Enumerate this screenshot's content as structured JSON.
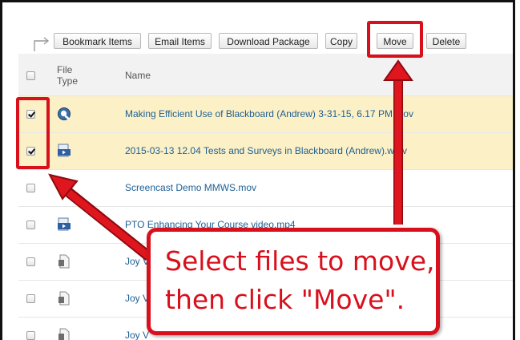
{
  "toolbar": {
    "buttons": [
      "Bookmark Items",
      "Email Items",
      "Download Package",
      "Copy",
      "Move",
      "Delete"
    ]
  },
  "table": {
    "headers": {
      "file_type": "File Type",
      "name": "Name"
    },
    "rows": [
      {
        "name": "Making Efficient Use of Blackboard (Andrew) 3-31-15, 6.17 PM.mov",
        "checked": true,
        "icon": "quicktime-video-icon"
      },
      {
        "name": "2015-03-13 12.04 Tests and Surveys in Blackboard (Andrew).wmv",
        "checked": true,
        "icon": "windows-media-video-icon"
      },
      {
        "name": "Screencast Demo MMWS.mov",
        "checked": false,
        "icon": "quicktime-video-icon"
      },
      {
        "name": "PTO Enhancing Your Course video.mp4",
        "checked": false,
        "icon": "windows-media-video-icon"
      },
      {
        "name": "Joy V",
        "checked": false,
        "icon": "generic-file-icon"
      },
      {
        "name": "Joy V",
        "checked": false,
        "icon": "generic-file-icon"
      },
      {
        "name": "Joy V",
        "checked": false,
        "icon": "generic-file-icon"
      }
    ]
  },
  "callout": {
    "line1": "Select files to move,",
    "line2": "then click \"Move\"."
  },
  "colors": {
    "annotation_red": "#d8101c",
    "selected_row": "#fcf0c6",
    "link_blue": "#1e5f93"
  }
}
